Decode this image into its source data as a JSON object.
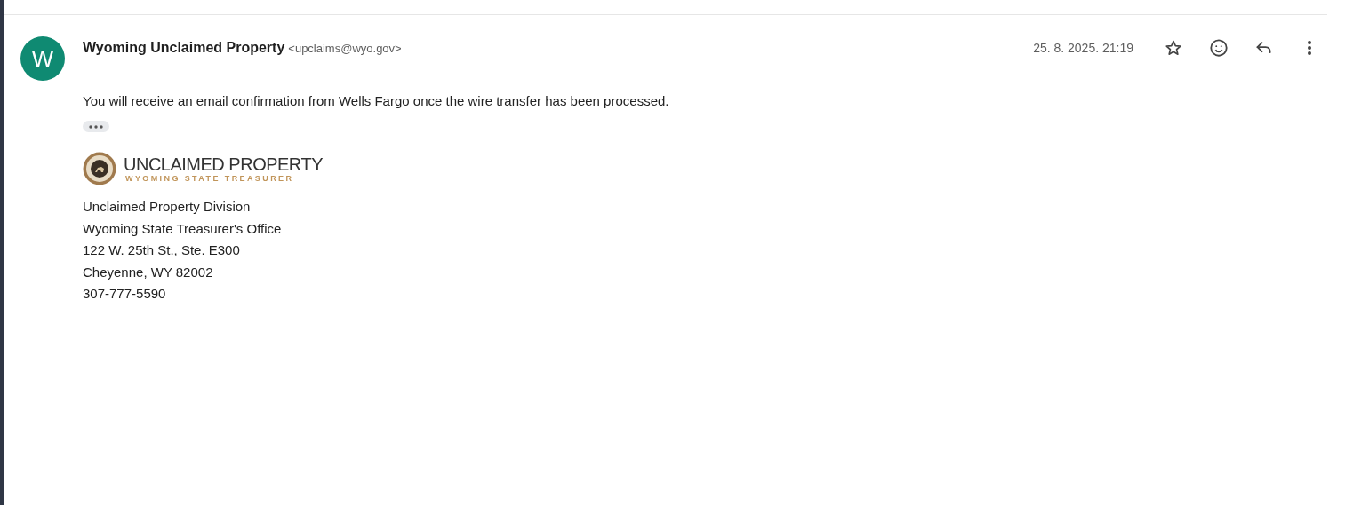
{
  "message": {
    "avatar_letter": "W",
    "sender_name": "Wyoming Unclaimed Property",
    "sender_email": "<upclaims@wyo.gov>",
    "date": "25. 8. 2025. 21:19",
    "starred": false,
    "body": "You will receive an email confirmation from Wells Fargo once the wire transfer has been processed.",
    "signature": {
      "logo_title": "UNCLAIMED PROPERTY",
      "logo_subtitle": "WYOMING STATE TREASURER",
      "lines": [
        "Unclaimed Property Division",
        "Wyoming State Treasurer's Office",
        "122 W. 25th St., Ste. E300",
        "Cheyenne, WY 82002",
        "307-777-5590"
      ]
    }
  }
}
